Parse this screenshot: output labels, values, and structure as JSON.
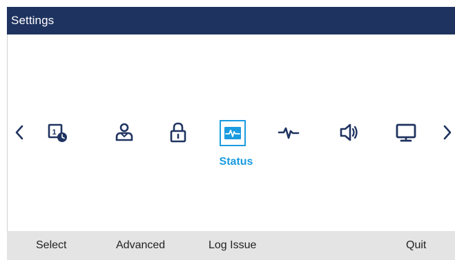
{
  "title_bar": {
    "title": "Settings"
  },
  "carousel": {
    "items": [
      {
        "icon": "time-date-icon"
      },
      {
        "icon": "user-account-icon"
      },
      {
        "icon": "lock-icon"
      },
      {
        "icon": "status-icon",
        "label": "Status",
        "selected": true
      },
      {
        "icon": "diagnostics-pulse-icon"
      },
      {
        "icon": "speaker-audio-icon"
      },
      {
        "icon": "display-monitor-icon"
      }
    ],
    "accent_color": "#1b9be0"
  },
  "softkeys": {
    "select": "Select",
    "advanced": "Advanced",
    "log_issue": "Log Issue",
    "quit": "Quit"
  },
  "colors": {
    "title_bar_bg": "#1f3360",
    "softkey_bar_bg": "#e4e4e4",
    "icon_color": "#1f3360"
  }
}
